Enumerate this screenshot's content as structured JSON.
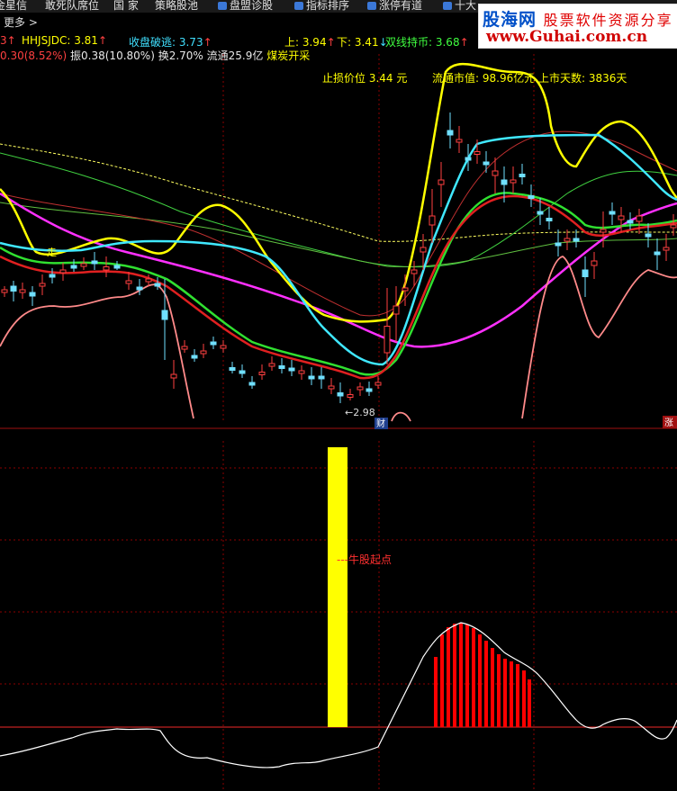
{
  "toolbar": {
    "items": [
      "金星信",
      "敢死队席位",
      "国 家",
      "策略股池",
      "盘盟诊股",
      "指标排序",
      "涨停有道",
      "十大"
    ],
    "more_label": "更多",
    "more_arrow": ">"
  },
  "logo": {
    "cn_a": "股海网",
    "cn_b": "股票软件资源分享",
    "url": "www.Guhai.com.cn"
  },
  "indicators": {
    "row1": {
      "prefix": "3",
      "hhjsjdc": "HHJSJDC: 3.81",
      "shoupan": "收盘破逃: 3.73",
      "up": "上: 3.94",
      "down": "下: 3.41",
      "shuangxian": "双线持币: 3.68"
    },
    "row2": {
      "change": "0.30(8.52%)",
      "amplitude": "振0.38(10.80%)",
      "turnover": "换2.70%",
      "float": "流通25.9亿",
      "sector": "煤炭开采"
    },
    "row3": {
      "stoploss": "止损价位 3.44 元",
      "mktcap": "流通市值: 98.96亿元",
      "days": "上市天数: 3836天"
    }
  },
  "price_chart": {
    "low_marker": "←2.98",
    "cai_badge": "财",
    "zhang_badge": "涨",
    "zou_label": "走",
    "colors": {
      "yellow": "#ffff00",
      "cyan": "#40e8ff",
      "magenta": "#ff30ff",
      "green": "#30e030",
      "red": "#e02020",
      "salmon": "#ff8a8a",
      "candle_up": "#ff4040",
      "candle_down": "#70e0ff"
    }
  },
  "sub_chart": {
    "annotation": "---牛股起点",
    "bar_color": "#ffff00",
    "stripe_color": "#ff0000",
    "line_color": "#ffffff",
    "baseline_color": "#c02020"
  }
}
